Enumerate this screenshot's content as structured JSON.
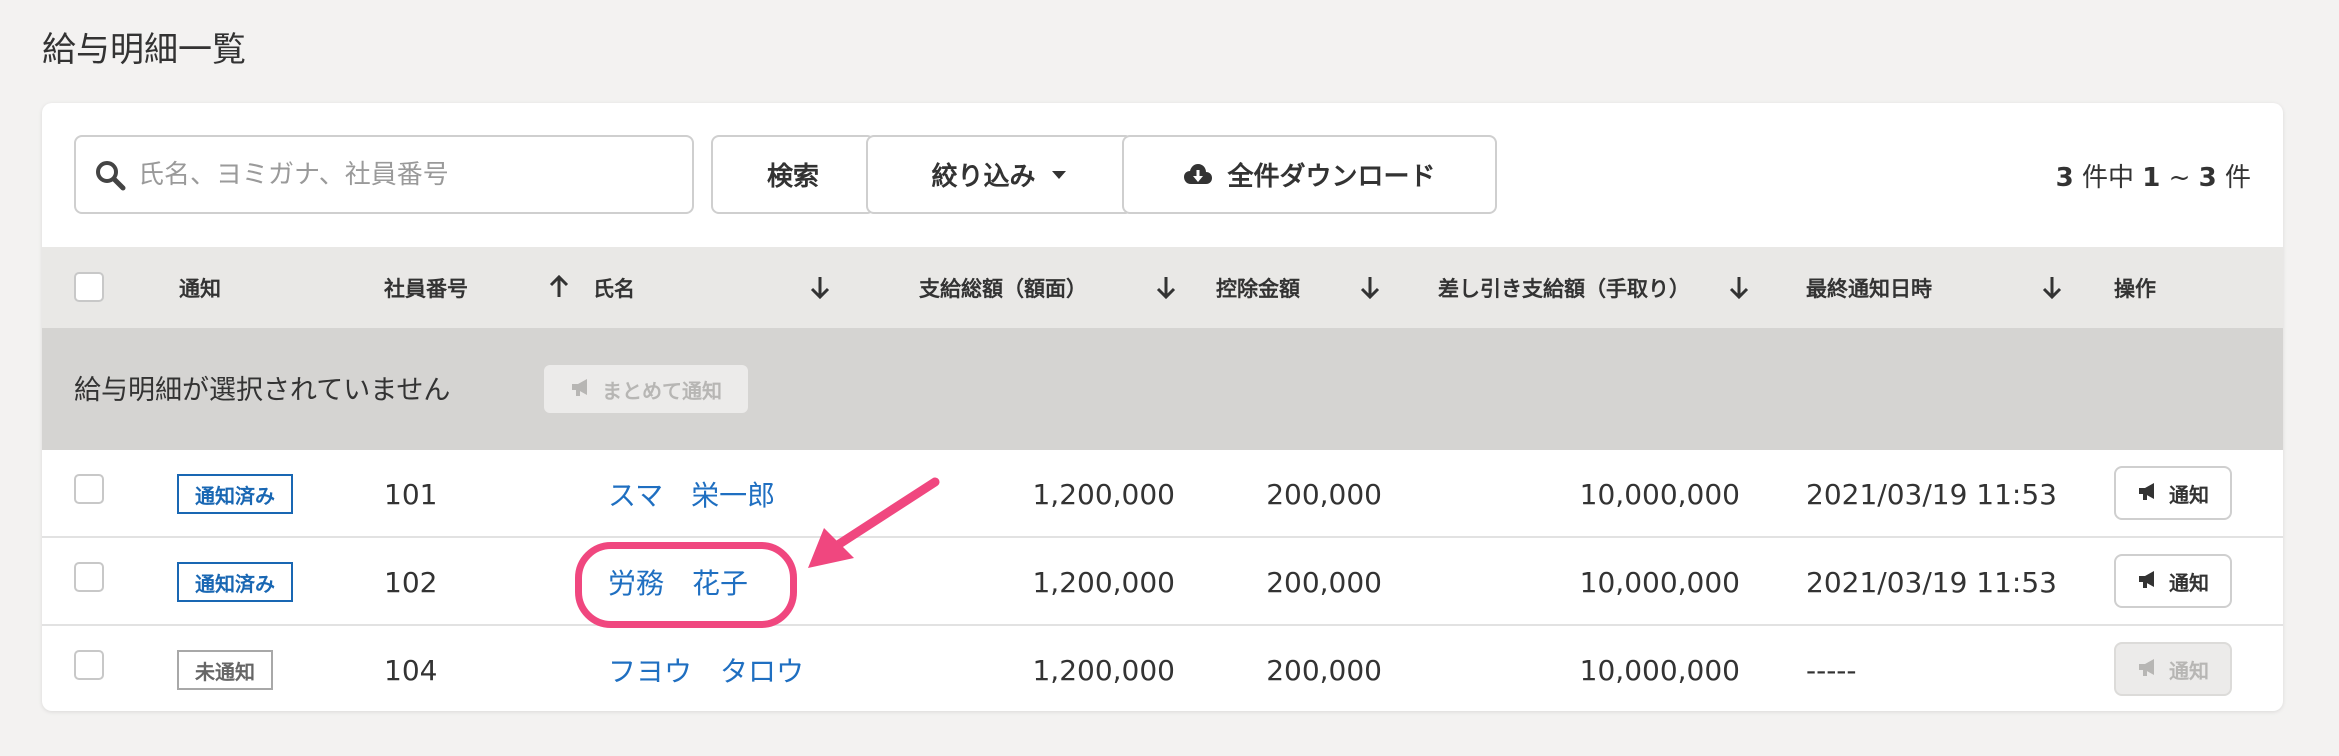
{
  "page": {
    "title": "給与明細一覧"
  },
  "toolbar": {
    "search_placeholder": "氏名、ヨミガナ、社員番号",
    "search_button": "検索",
    "filter_button": "絞り込み",
    "download_button": "全件ダウンロード",
    "count": {
      "total": "3",
      "mid": " 件中 ",
      "start": "1",
      "sep": " ~ ",
      "end": "3",
      "suffix": " 件"
    }
  },
  "table": {
    "headers": {
      "notify": "通知",
      "employee_no": "社員番号",
      "name": "氏名",
      "gross": "支給総額（額面）",
      "deduction": "控除金額",
      "net": "差し引き支給額（手取り）",
      "last_notified": "最終通知日時",
      "actions": "操作"
    },
    "banner": {
      "text": "給与明細が選択されていません",
      "bulk_button": "まとめて通知"
    },
    "rows": [
      {
        "status": "通知済み",
        "status_type": "done",
        "employee_no": "101",
        "name": "スマ　栄一郎",
        "gross": "1,200,000",
        "deduction": "200,000",
        "net": "10,000,000",
        "last_notified": "2021/03/19 11:53",
        "action": "通知",
        "action_enabled": true
      },
      {
        "status": "通知済み",
        "status_type": "done",
        "employee_no": "102",
        "name": "労務　花子",
        "gross": "1,200,000",
        "deduction": "200,000",
        "net": "10,000,000",
        "last_notified": "2021/03/19 11:53",
        "action": "通知",
        "action_enabled": true
      },
      {
        "status": "未通知",
        "status_type": "not",
        "employee_no": "104",
        "name": "フヨウ　タロウ",
        "gross": "1,200,000",
        "deduction": "200,000",
        "net": "10,000,000",
        "last_notified": "-----",
        "action": "通知",
        "action_enabled": false
      }
    ]
  },
  "colors": {
    "link": "#1f6fc1",
    "status_done": "#1967b3",
    "annotation": "#f0477f",
    "header_bg": "#e9e8e6",
    "banner_bg": "#d5d4d2"
  },
  "icons": {
    "search": "search-icon",
    "filter": "caret-down-icon",
    "download": "cloud-download-icon",
    "notify": "megaphone-icon",
    "sort_up": "arrow-up-icon",
    "sort_down": "arrow-down-icon"
  }
}
